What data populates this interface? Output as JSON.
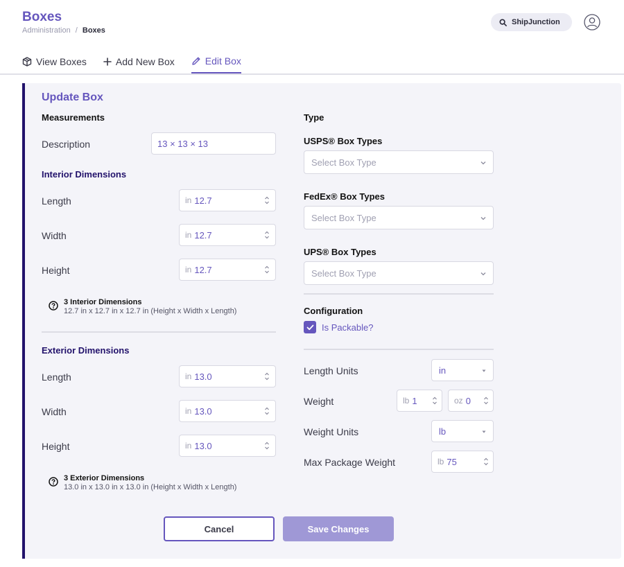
{
  "header": {
    "title": "Boxes",
    "breadcrumb": {
      "parent": "Administration",
      "separator": "/",
      "current": "Boxes"
    },
    "org_name": "ShipJunction"
  },
  "tabs": [
    {
      "label": "View Boxes",
      "icon": "box-icon",
      "active": false
    },
    {
      "label": "Add New Box",
      "icon": "plus-icon",
      "active": false
    },
    {
      "label": "Edit Box",
      "icon": "pencil-icon",
      "active": true
    }
  ],
  "form": {
    "title": "Update Box",
    "measurements": {
      "heading": "Measurements",
      "description_label": "Description",
      "description_value": "13 × 13 × 13"
    },
    "interior": {
      "heading": "Interior Dimensions",
      "fields": [
        {
          "label": "Length",
          "unit": "in",
          "value": "12.7"
        },
        {
          "label": "Width",
          "unit": "in",
          "value": "12.7"
        },
        {
          "label": "Height",
          "unit": "in",
          "value": "12.7"
        }
      ],
      "summary_title": "3 Interior Dimensions",
      "summary_text": "12.7 in x 12.7 in x 12.7 in (Height x Width x Length)"
    },
    "exterior": {
      "heading": "Exterior Dimensions",
      "fields": [
        {
          "label": "Length",
          "unit": "in",
          "value": "13.0"
        },
        {
          "label": "Width",
          "unit": "in",
          "value": "13.0"
        },
        {
          "label": "Height",
          "unit": "in",
          "value": "13.0"
        }
      ],
      "summary_title": "3 Exterior Dimensions",
      "summary_text": "13.0 in x 13.0 in x 13.0 in (Height x Width x Length)"
    },
    "type": {
      "heading": "Type",
      "usps_label": "USPS® Box Types",
      "fedex_label": "FedEx® Box Types",
      "ups_label": "UPS® Box Types",
      "select_placeholder": "Select Box Type"
    },
    "configuration": {
      "heading": "Configuration",
      "packable_label": "Is Packable?",
      "packable_checked": true
    },
    "units": {
      "length_units_label": "Length Units",
      "length_units_value": "in",
      "weight_label": "Weight",
      "weight_lb_unit": "lb",
      "weight_lb_value": "1",
      "weight_oz_unit": "oz",
      "weight_oz_value": "0",
      "weight_units_label": "Weight Units",
      "weight_units_value": "lb",
      "max_weight_label": "Max Package Weight",
      "max_weight_unit": "lb",
      "max_weight_value": "75"
    },
    "buttons": {
      "cancel": "Cancel",
      "save": "Save Changes"
    }
  },
  "colors": {
    "accent": "#6556bd",
    "navy": "#22126b",
    "card_bg": "#f4f4f9",
    "save_disabled": "#9f98d6"
  }
}
